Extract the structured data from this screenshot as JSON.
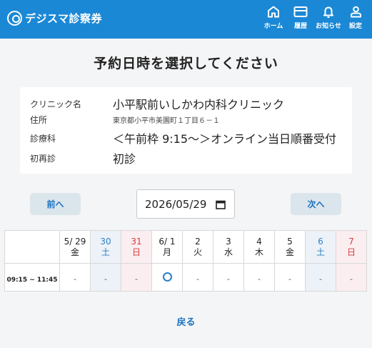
{
  "header": {
    "app_name": "デジスマ診察券",
    "brand_color": "#1b88d6",
    "nav": [
      {
        "label": "ホーム",
        "icon": "home-icon"
      },
      {
        "label": "履歴",
        "icon": "card-icon"
      },
      {
        "label": "お知らせ",
        "icon": "bell-icon"
      },
      {
        "label": "設定",
        "icon": "person-icon"
      }
    ]
  },
  "page_title": "予約日時を選択してください",
  "info": {
    "clinic_key": "クリニック名",
    "clinic_val": "小平駅前いしかわ内科クリニック",
    "address_key": "住所",
    "address_val": "東京都小平市美園町１丁目６－１",
    "dept_key": "診療科",
    "dept_val": "＜午前枠 9:15～＞オンライン当日順番受付",
    "visit_key": "初再診",
    "visit_val": "初診"
  },
  "controls": {
    "prev_label": "前へ",
    "next_label": "次へ",
    "date_value": "2026/05/29"
  },
  "table": {
    "days": [
      {
        "num": "5/ 29",
        "wd": "金",
        "type": "weekday"
      },
      {
        "num": "30",
        "wd": "土",
        "type": "sat"
      },
      {
        "num": "31",
        "wd": "日",
        "type": "sun"
      },
      {
        "num": "6/ 1",
        "wd": "月",
        "type": "weekday"
      },
      {
        "num": "2",
        "wd": "火",
        "type": "weekday"
      },
      {
        "num": "3",
        "wd": "水",
        "type": "weekday"
      },
      {
        "num": "4",
        "wd": "木",
        "type": "weekday"
      },
      {
        "num": "5",
        "wd": "金",
        "type": "weekday"
      },
      {
        "num": "6",
        "wd": "土",
        "type": "sat"
      },
      {
        "num": "7",
        "wd": "日",
        "type": "sun"
      }
    ],
    "slots": [
      {
        "time": "09:15 ~ 11:45",
        "cells": [
          "-",
          "-",
          "-",
          "○",
          "-",
          "-",
          "-",
          "-",
          "-",
          "-"
        ]
      }
    ]
  },
  "back_label": "戻る"
}
